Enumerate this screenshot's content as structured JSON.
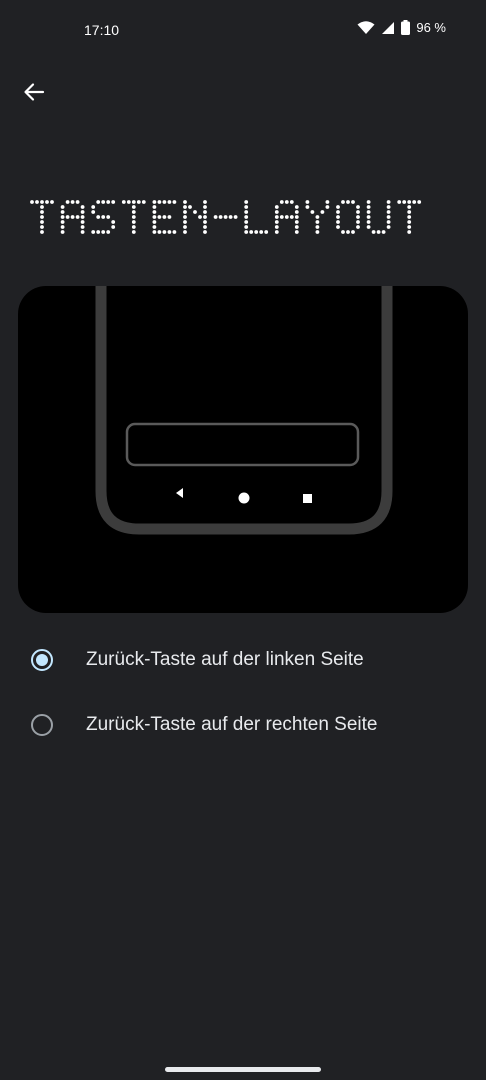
{
  "status_bar": {
    "time": "17:10",
    "battery": "96 %",
    "icons": [
      "wifi-icon",
      "signal-icon",
      "battery-icon"
    ]
  },
  "header": {
    "back_icon": "arrow-back-icon",
    "title": "TASTEN-LAYOUT"
  },
  "illustration": {
    "nav_icons": [
      "back-triangle-icon",
      "home-circle-icon",
      "recents-square-icon"
    ]
  },
  "options": [
    {
      "label": "Zurück-Taste auf der linken Seite",
      "selected": true
    },
    {
      "label": "Zurück-Taste auf der rechten Seite",
      "selected": false
    }
  ],
  "colors": {
    "background": "#202124",
    "accent": "#c2e7ff",
    "text": "#e8eaed"
  }
}
